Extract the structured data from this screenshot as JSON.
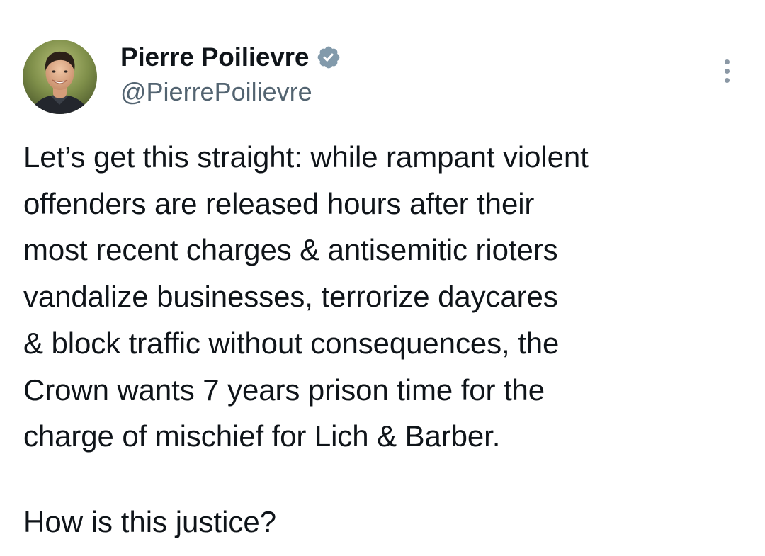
{
  "author": {
    "display_name": "Pierre Poilievre",
    "handle": "@PierrePoilievre",
    "verified": true
  },
  "icons": {
    "avatar": "profile-photo",
    "verified": "verified-badge-icon",
    "more": "more-options-icon"
  },
  "colors": {
    "text": "#0f1419",
    "secondary_text": "#536471",
    "verified_badge": "#829aab",
    "divider": "#e6ecf0"
  },
  "tweet": {
    "lines": [
      "Let’s get this straight: while rampant violent",
      "offenders are released hours after their",
      "most recent charges & antisemitic rioters",
      "vandalize businesses, terrorize daycares",
      "& block traffic without consequences, the",
      "Crown wants 7 years prison time for the",
      "charge of mischief for Lich & Barber."
    ],
    "question": "How is this justice?"
  }
}
